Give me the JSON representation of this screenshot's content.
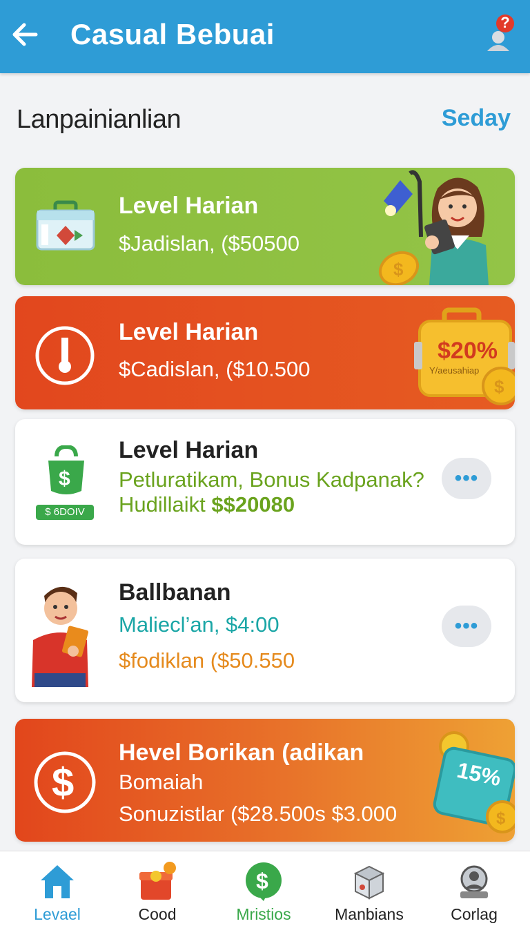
{
  "app_bar": {
    "title": "Casual Bebuai",
    "notification_badge": "?"
  },
  "section": {
    "title": "Lanpainianlian",
    "action": "Seday"
  },
  "cards": [
    {
      "title": "Level Harian",
      "line1": "$Jadislan, ($50500",
      "icon": "lunchbox-icon",
      "art": "girl-with-tablet-lamp-coin"
    },
    {
      "title": "Level Harian",
      "line1": "$Cadislan, ($10.500",
      "icon": "number-one-badge-icon",
      "art_badge": "$20%",
      "art_badge_sub": "Y/aeusahiap"
    },
    {
      "title": "Level Harian",
      "line1": "Petluratikam, Bonus Kadpanak?",
      "line2_prefix": "Hudillaikt ",
      "line2_amount": "$$20080",
      "icon": "money-bag-icon",
      "icon_tag": "$ 6DOIV"
    },
    {
      "title": "Ballbanan",
      "line1": "Maliecl’an, $4:00",
      "line2": "$fodiklan ($50.550",
      "icon": "man-with-tablet-avatar"
    },
    {
      "title": "Hevel Borikan (adikan",
      "line1": "Bomaiah",
      "line2": "Sonuzistlar ($28.500s $3.000",
      "icon": "dollar-circle-icon",
      "art_badge": "15%"
    }
  ],
  "bottom_nav": [
    {
      "label": "Levael",
      "icon": "home-icon",
      "active": true
    },
    {
      "label": "Cood",
      "icon": "gift-box-icon"
    },
    {
      "label": "Mristios",
      "icon": "dollar-bubble-icon"
    },
    {
      "label": "Manbians",
      "icon": "box-icon"
    },
    {
      "label": "Corlag",
      "icon": "user-profile-icon"
    }
  ],
  "colors": {
    "primary": "#2e9cd6",
    "green_card": "#8bbd3c",
    "red_card": "#e2471e",
    "orange_card": "#e8732a"
  }
}
